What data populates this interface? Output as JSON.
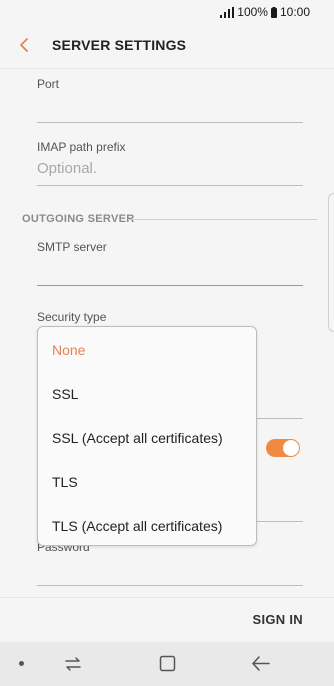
{
  "status_bar": {
    "battery_percent": "100%",
    "time": "10:00",
    "icons": [
      "signal-icon",
      "battery-icon"
    ]
  },
  "header": {
    "title": "SERVER SETTINGS",
    "back_icon": "back-arrow-icon"
  },
  "incoming": {
    "port_label": "Port",
    "imap_label": "IMAP path prefix",
    "imap_placeholder": "Optional."
  },
  "outgoing": {
    "section_title": "OUTGOING SERVER",
    "smtp_label": "SMTP server",
    "security_label": "Security type",
    "password_label": "Password"
  },
  "dropdown": {
    "options": [
      {
        "label": "None",
        "selected": true
      },
      {
        "label": "SSL",
        "selected": false
      },
      {
        "label": "SSL (Accept all certificates)",
        "selected": false
      },
      {
        "label": "TLS",
        "selected": false
      },
      {
        "label": "TLS (Accept all certificates)",
        "selected": false
      }
    ]
  },
  "toggle": {
    "on": true
  },
  "footer": {
    "sign_in": "SIGN IN"
  },
  "colors": {
    "accent": "#e88254",
    "toggle": "#f08a42",
    "background": "#f5f5f5",
    "nav_bar": "#e9e9e9"
  }
}
